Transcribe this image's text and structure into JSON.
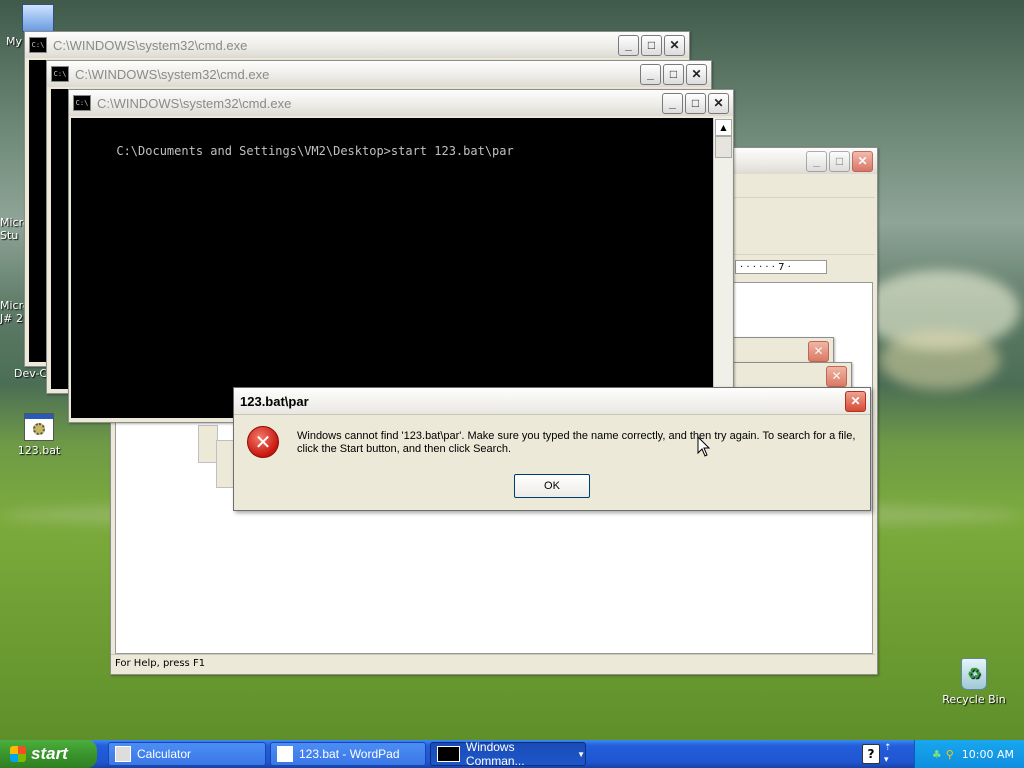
{
  "desktop": {
    "icons": [
      {
        "label": "My"
      },
      {
        "label": "Micro\nStu"
      },
      {
        "label": "Micro\nJ# 2"
      },
      {
        "label": "Dev-C"
      },
      {
        "label": "123.bat"
      },
      {
        "label": "Recycle Bin"
      }
    ]
  },
  "cmd_windows": [
    {
      "title": "C:\\WINDOWS\\system32\\cmd.exe"
    },
    {
      "title": "C:\\WINDOWS\\system32\\cmd.exe"
    },
    {
      "title": "C:\\WINDOWS\\system32\\cmd.exe",
      "line": "C:\\Documents and Settings\\VM2\\Desktop>start 123.bat\\par"
    }
  ],
  "cmd_icon_text": "C:\\",
  "wordpad": {
    "ruler_text": "· · · · · · 7 ·",
    "status_text": "For Help, press F1"
  },
  "dialog": {
    "title": "123.bat\\par",
    "message": "Windows cannot find '123.bat\\par'. Make sure you typed the name correctly, and then try again. To search for a file, click the Start button, and then click Search.",
    "ok_label": "OK",
    "icon": "error-icon"
  },
  "taskbar": {
    "start_label": "start",
    "buttons": [
      {
        "label": "Calculator"
      },
      {
        "label": "123.bat - WordPad"
      },
      {
        "label": "Windows Comman..."
      }
    ],
    "clock": "10:00 AM"
  },
  "colors": {
    "cmd_bg": "#000000",
    "taskbar_blue": "#245edb",
    "start_green": "#3d9a2f",
    "close_red": "#d44c35"
  }
}
